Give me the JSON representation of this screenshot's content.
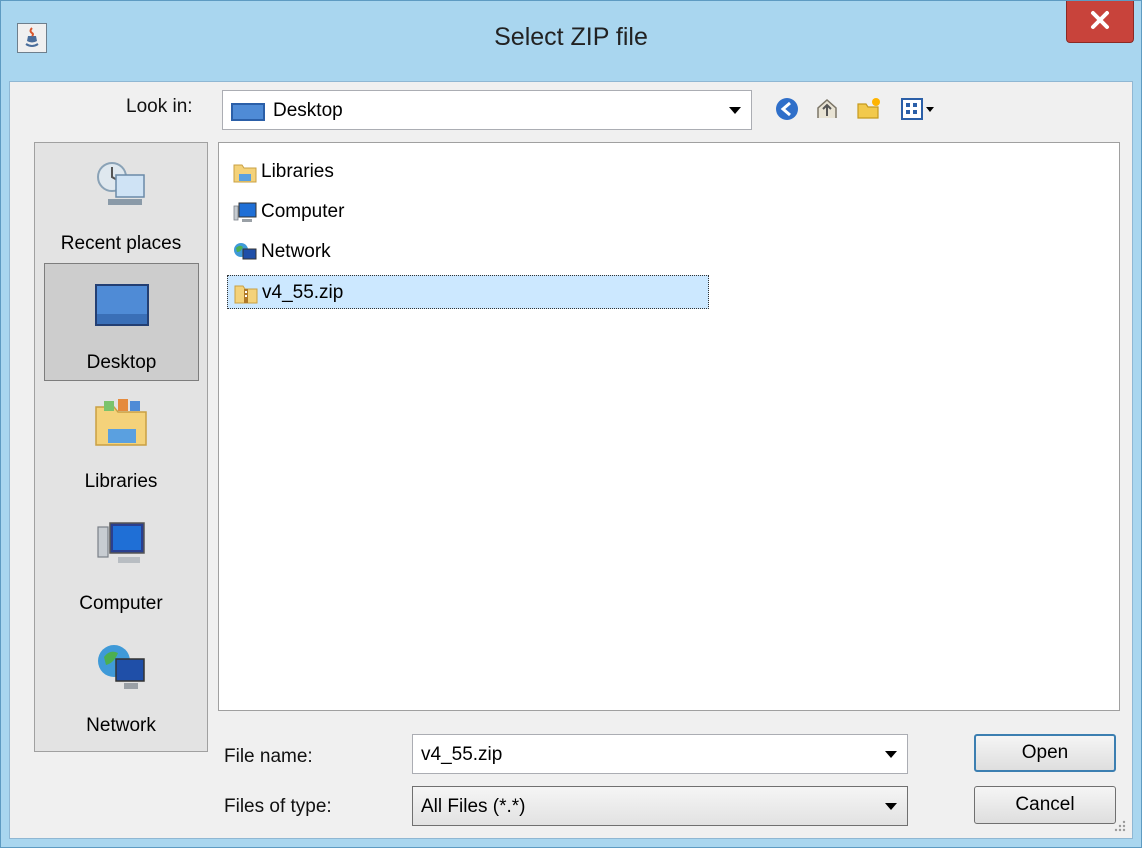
{
  "window": {
    "title": "Select ZIP file"
  },
  "toolbar": {
    "look_in_label": "Look in:",
    "look_in_value": "Desktop",
    "icons": [
      "back-icon",
      "up-folder-icon",
      "new-folder-icon",
      "view-menu-icon"
    ]
  },
  "places": [
    {
      "label": "Recent places",
      "icon": "recent-places-icon",
      "selected": false
    },
    {
      "label": "Desktop",
      "icon": "desktop-icon",
      "selected": true
    },
    {
      "label": "Libraries",
      "icon": "libraries-icon",
      "selected": false
    },
    {
      "label": "Computer",
      "icon": "computer-icon",
      "selected": false
    },
    {
      "label": "Network",
      "icon": "network-icon",
      "selected": false
    }
  ],
  "files": [
    {
      "label": "Libraries",
      "icon": "libraries-folder-icon",
      "selected": false
    },
    {
      "label": "Computer",
      "icon": "computer-icon",
      "selected": false
    },
    {
      "label": "Network",
      "icon": "network-icon",
      "selected": false
    },
    {
      "label": "v4_55.zip",
      "icon": "zip-file-icon",
      "selected": true
    }
  ],
  "footer": {
    "file_name_label": "File name:",
    "file_name_value": "v4_55.zip",
    "file_type_label": "Files of type:",
    "file_type_value": "All Files (*.*)",
    "open_label": "Open",
    "cancel_label": "Cancel"
  },
  "colors": {
    "title_bar": "#a9d6ef",
    "close_button": "#c8433b",
    "selection": "#cce8ff"
  }
}
